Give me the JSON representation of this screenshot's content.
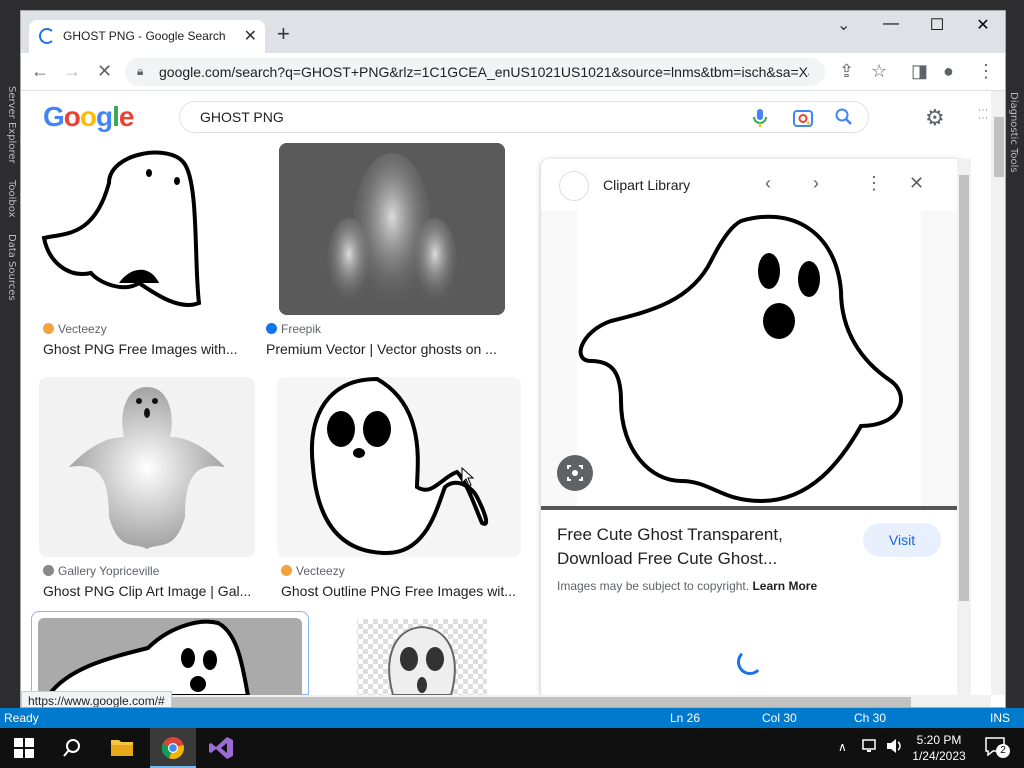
{
  "ide": {
    "left_tabs": [
      "Server Explorer",
      "Toolbox",
      "Data Sources"
    ],
    "right_tab": "Diagnostic Tools",
    "status": {
      "ready": "Ready",
      "ln": "Ln 26",
      "col": "Col 30",
      "ch": "Ch 30",
      "ins": "INS"
    }
  },
  "browser": {
    "tab_title": "GHOST PNG - Google Search",
    "tab_close": "✕",
    "new_tab": "+",
    "tab_search": "⌄",
    "window": {
      "minimize": "—",
      "maximize": "☐",
      "close": "✕"
    },
    "nav": {
      "back": "←",
      "forward": "→",
      "stop": "✕"
    },
    "url": "google.com/search?q=GHOST+PNG&rlz=1C1GCEA_enUS1021US1021&source=lnms&tbm=isch&sa=X&v...",
    "toolbar_icons": {
      "share": "⇪",
      "bookmark": "☆",
      "sidepanel": "◨",
      "profile": "●",
      "menu": "⋮"
    },
    "hover_url": "https://www.google.com/#"
  },
  "google": {
    "logo": [
      "G",
      "o",
      "o",
      "g",
      "l",
      "e"
    ],
    "logo_colors": [
      "#4285F4",
      "#EA4335",
      "#FBBC05",
      "#4285F4",
      "#34A853",
      "#EA4335"
    ],
    "query": "GHOST PNG",
    "settings_icon": "⚙",
    "apps_icon": "⋮⋮⋮"
  },
  "results": [
    {
      "source": "Vecteezy",
      "source_color": "#f4a23b",
      "title": "Ghost PNG Free Images with..."
    },
    {
      "source": "Freepik",
      "source_color": "#1273eb",
      "title": "Premium Vector | Vector ghosts on ..."
    },
    {
      "source": "Gallery Yopriceville",
      "source_color": "#888888",
      "title": "Ghost PNG Clip Art Image | Gal..."
    },
    {
      "source": "Vecteezy",
      "source_color": "#f4a23b",
      "title": "Ghost Outline PNG Free Images wit..."
    }
  ],
  "panel": {
    "site": "Clipart Library",
    "title": "Free Cute Ghost Transparent, Download Free Cute Ghost...",
    "visit": "Visit",
    "copyright": "Images may be subject to copyright.",
    "learn_more": "Learn More",
    "icons": {
      "prev": "‹",
      "next": "›",
      "more": "⋮",
      "close": "✕"
    }
  },
  "taskbar": {
    "time": "5:20 PM",
    "date": "1/24/2023",
    "notifications": "2"
  }
}
